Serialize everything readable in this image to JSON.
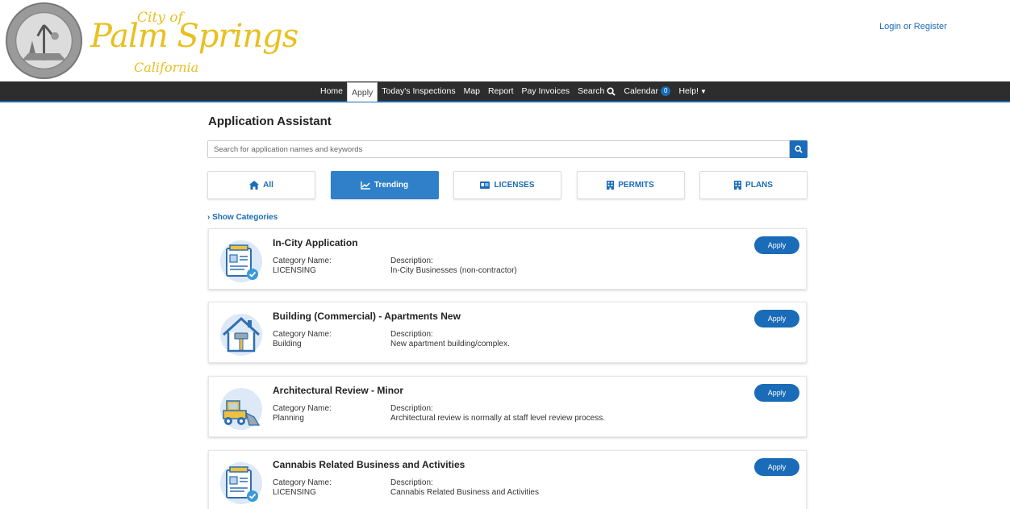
{
  "header": {
    "logo_city": "City of",
    "logo_main": "Palm Springs",
    "logo_state": "California",
    "seal_text": "CITY OF PALM SPRINGS · CALIFORNIA",
    "login_link": "Login or Register"
  },
  "nav": {
    "items": [
      {
        "label": "Home"
      },
      {
        "label": "Apply"
      },
      {
        "label": "Today's Inspections"
      },
      {
        "label": "Map"
      },
      {
        "label": "Report"
      },
      {
        "label": "Pay Invoices"
      },
      {
        "label": "Search"
      },
      {
        "label": "Calendar"
      },
      {
        "label": "Help!"
      }
    ],
    "active": "Apply",
    "calendar_badge": "0"
  },
  "main": {
    "title": "Application Assistant",
    "search_placeholder": "Search for application names and keywords",
    "filters": [
      {
        "label": "All",
        "icon": "home-icon"
      },
      {
        "label": "Trending",
        "icon": "chart-line-icon"
      },
      {
        "label": "LICENSES",
        "icon": "id-card-icon"
      },
      {
        "label": "PERMITS",
        "icon": "building-icon"
      },
      {
        "label": "PLANS",
        "icon": "building-icon"
      }
    ],
    "active_filter": "Trending",
    "show_categories": "Show Categories"
  },
  "cards": [
    {
      "title": "In-City Application",
      "category_label": "Category Name:",
      "category": "LICENSING",
      "description_label": "Description:",
      "description": "In-City Businesses (non-contractor)",
      "apply": "Apply",
      "icon": "license-document-icon"
    },
    {
      "title": "Building (Commercial) - Apartments New",
      "category_label": "Category Name:",
      "category": "Building",
      "description_label": "Description:",
      "description": "New apartment building/complex.",
      "apply": "Apply",
      "icon": "house-hammer-icon"
    },
    {
      "title": "Architectural Review - Minor",
      "category_label": "Category Name:",
      "category": "Planning",
      "description_label": "Description:",
      "description": "Architectural review is normally at staff level review process.",
      "apply": "Apply",
      "icon": "bulldozer-icon"
    },
    {
      "title": "Cannabis Related Business and Activities",
      "category_label": "Category Name:",
      "category": "LICENSING",
      "description_label": "Description:",
      "description": "Cannabis Related Business and Activities",
      "apply": "Apply",
      "icon": "license-document-icon"
    }
  ],
  "colors": {
    "brand_blue": "#1a6bb8",
    "nav_bg": "#2d2d2d",
    "logo_gold": "#e8c020",
    "active_filter_bg": "#2f80c9"
  }
}
